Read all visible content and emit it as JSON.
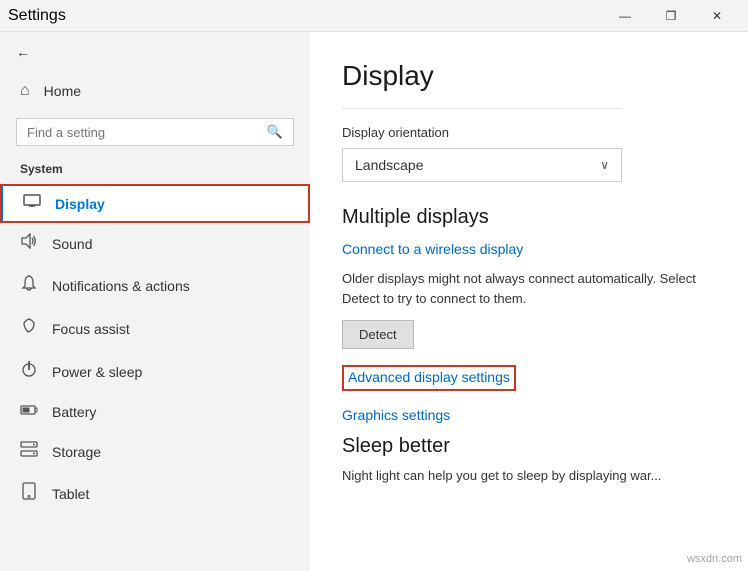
{
  "titlebar": {
    "title": "Settings",
    "minimize_label": "—",
    "maximize_label": "❐",
    "close_label": "✕"
  },
  "sidebar": {
    "back_icon": "←",
    "app_title": "Settings",
    "home_icon": "⌂",
    "home_label": "Home",
    "search_placeholder": "Find a setting",
    "search_icon": "🔍",
    "section_title": "System",
    "items": [
      {
        "id": "display",
        "icon": "▭",
        "label": "Display",
        "active": true,
        "highlighted": true
      },
      {
        "id": "sound",
        "icon": "🔊",
        "label": "Sound",
        "active": false
      },
      {
        "id": "notifications",
        "icon": "🔔",
        "label": "Notifications & actions",
        "active": false
      },
      {
        "id": "focus",
        "icon": "🌙",
        "label": "Focus assist",
        "active": false
      },
      {
        "id": "power",
        "icon": "⏻",
        "label": "Power & sleep",
        "active": false
      },
      {
        "id": "battery",
        "icon": "🔋",
        "label": "Battery",
        "active": false
      },
      {
        "id": "storage",
        "icon": "💾",
        "label": "Storage",
        "active": false
      },
      {
        "id": "tablet",
        "icon": "⬜",
        "label": "Tablet",
        "active": false
      }
    ]
  },
  "content": {
    "title": "Display",
    "orientation_label": "Display orientation",
    "orientation_value": "Landscape",
    "multiple_displays_heading": "Multiple displays",
    "wireless_display_link": "Connect to a wireless display",
    "older_displays_text": "Older displays might not always connect automatically. Select Detect to try to connect to them.",
    "detect_button_label": "Detect",
    "advanced_display_link": "Advanced display settings",
    "graphics_settings_link": "Graphics settings",
    "sleep_heading": "Sleep better",
    "sleep_text": "Night light can help you get to sleep by displaying war..."
  },
  "watermark": {
    "text": "wsxdn.com"
  }
}
